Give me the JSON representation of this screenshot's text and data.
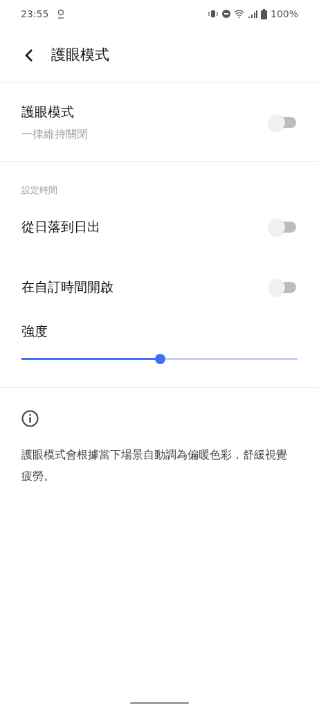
{
  "status_bar": {
    "time": "23:55",
    "battery": "100%"
  },
  "header": {
    "title": "護眼模式"
  },
  "main_toggle": {
    "title": "護眼模式",
    "subtitle": "一律維持關閉",
    "on": false
  },
  "section_label": "設定時間",
  "schedule_toggles": [
    {
      "title": "從日落到日出",
      "on": false
    },
    {
      "title": "在自訂時間開啟",
      "on": false
    }
  ],
  "intensity": {
    "title": "強度",
    "level": 0.5
  },
  "info": {
    "text": "護眼模式會根據當下場景自動調為偏暖色彩，舒緩視覺疲勞。"
  }
}
